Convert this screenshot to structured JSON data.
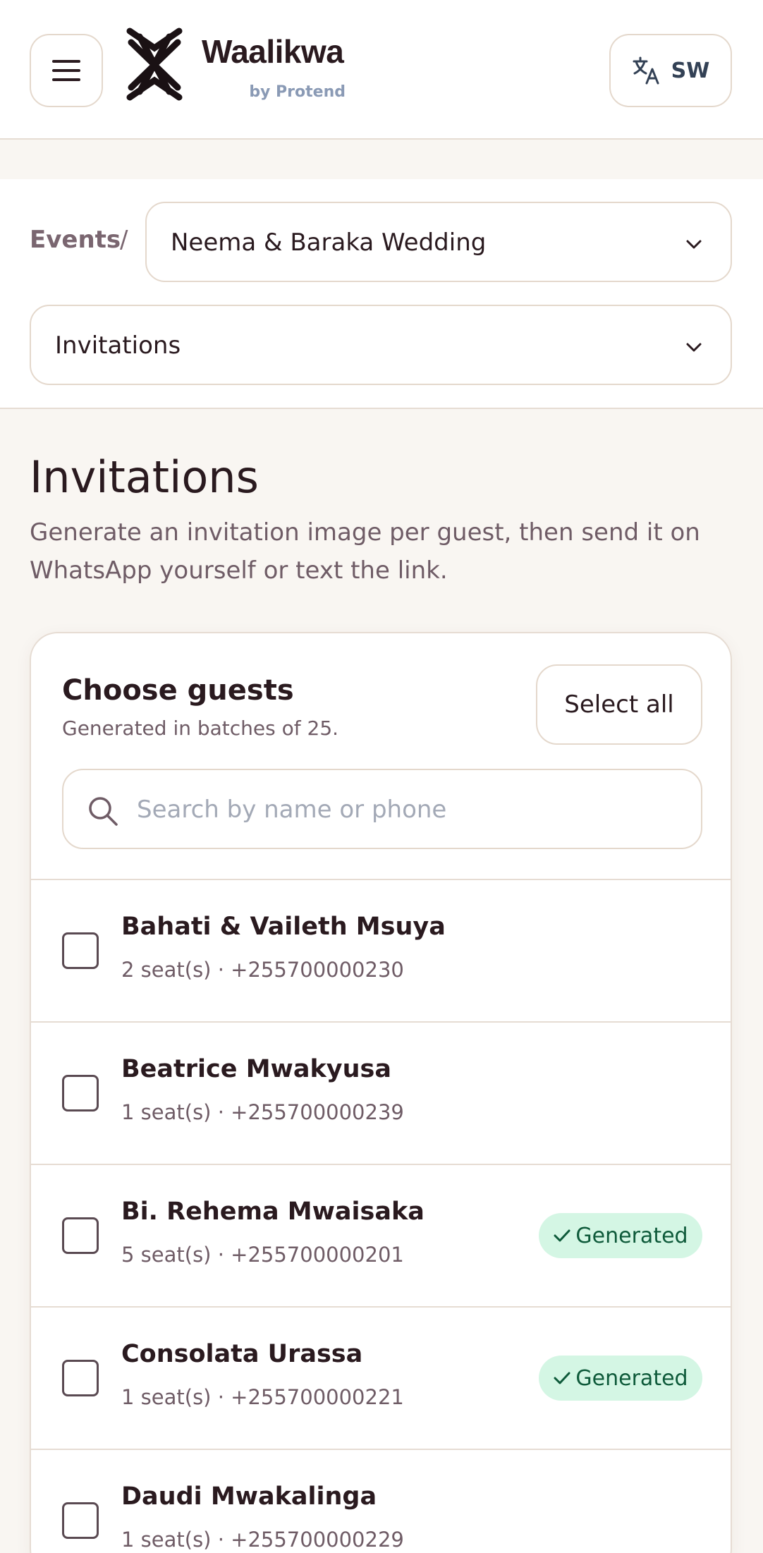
{
  "header": {
    "brand_name": "Waalikwa",
    "brand_sub": "by Protend",
    "language": "SW"
  },
  "breadcrumb": {
    "events": "Events",
    "separator": "/",
    "event_selected": "Neema & Baraka Wedding",
    "section_selected": "Invitations"
  },
  "page": {
    "title": "Invitations",
    "description": "Generate an invitation image per guest, then send it on WhatsApp yourself or text the link."
  },
  "card": {
    "title": "Choose guests",
    "subtitle": "Generated in batches of 25.",
    "select_all": "Select all",
    "search_placeholder": "Search by name or phone"
  },
  "guests": [
    {
      "name": "Bahati & Vaileth Msuya",
      "meta": "2 seat(s) · +255700000230",
      "status": ""
    },
    {
      "name": "Beatrice Mwakyusa",
      "meta": "1 seat(s) · +255700000239",
      "status": ""
    },
    {
      "name": "Bi. Rehema Mwaisaka",
      "meta": "5 seat(s) · +255700000201",
      "status": "Generated"
    },
    {
      "name": "Consolata Urassa",
      "meta": "1 seat(s) · +255700000221",
      "status": "Generated"
    },
    {
      "name": "Daudi Mwakalinga",
      "meta": "1 seat(s) · +255700000229",
      "status": ""
    }
  ],
  "colors": {
    "background": "#f9f6f2",
    "border": "#e4d8cc",
    "text": "#2a1a1f",
    "badge_bg": "#d4f6e4",
    "badge_text": "#0e5a3a"
  },
  "icons": {
    "menu": "hamburger-icon",
    "logo": "waalikwa-logo",
    "language": "translate-icon",
    "dropdown": "chevron-down-icon",
    "search": "search-icon",
    "generated": "check-icon"
  }
}
